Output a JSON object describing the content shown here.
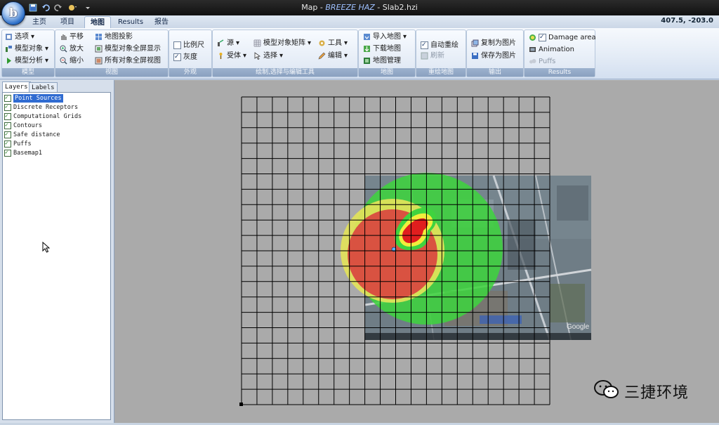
{
  "window": {
    "title_main": "Map - ",
    "title_brand": "BREEZE HAZ",
    "title_file": " - Slab2.hzi",
    "coordinates": "407.5, -203.0"
  },
  "tabs": [
    {
      "label": "主页",
      "active": false
    },
    {
      "label": "项目",
      "active": false
    },
    {
      "label": "地图",
      "active": true
    },
    {
      "label": "Results",
      "active": false
    },
    {
      "label": "报告",
      "active": false
    }
  ],
  "ribbon": {
    "model": {
      "label": "模型",
      "options": "选项",
      "model_objects": "模型对象",
      "model_analysis": "模型分析"
    },
    "view": {
      "label": "视图",
      "pan": "平移",
      "zoom_in": "放大",
      "zoom_out": "缩小",
      "map_projection": "地图投影",
      "fit_model_objects": "模型对象全屏显示",
      "fit_all_objects": "所有对象全屏视图"
    },
    "appearance": {
      "label": "外观",
      "scale": "比例尺",
      "grayscale": "灰度"
    },
    "draw": {
      "label": "绘制,选择与编辑工具",
      "source": "源",
      "receptor": "受体",
      "object_matrix": "模型对象矩阵",
      "select": "选择",
      "tools": "工具",
      "edit": "编辑"
    },
    "map": {
      "label": "地图",
      "import_map": "导入地图",
      "download_map": "下载地图",
      "map_manager": "地图管理"
    },
    "redraw": {
      "label": "重绘地图",
      "auto_redraw": "自动重绘",
      "refresh": "刷新"
    },
    "output": {
      "label": "输出",
      "copy_image": "复制为图片",
      "save_image": "保存为图片"
    },
    "results": {
      "label": "Results",
      "damage_area": "Damage area",
      "animation": "Animation",
      "puffs": "Puffs"
    }
  },
  "left_panel": {
    "tabs": [
      "Layers",
      "Labels"
    ],
    "layers": [
      {
        "label": "Point Sources",
        "checked": true,
        "selected": true
      },
      {
        "label": "Discrete Receptors",
        "checked": true,
        "selected": false
      },
      {
        "label": "Computational Grids",
        "checked": true,
        "selected": false
      },
      {
        "label": "Contours",
        "checked": true,
        "selected": false
      },
      {
        "label": "Safe distance",
        "checked": true,
        "selected": false
      },
      {
        "label": "Puffs",
        "checked": true,
        "selected": false
      },
      {
        "label": "Basemap1",
        "checked": true,
        "selected": false
      }
    ]
  },
  "map": {
    "grid_columns": 20,
    "grid_rows": 20,
    "zone_colors": {
      "outer": "#3fd33f",
      "middle": "#e3e35a",
      "inner": "#d93d3d",
      "background": "#aaaaaa"
    },
    "basemap_attribution": "Google"
  },
  "watermark": {
    "text": "三捷环境",
    "icon": "wechat-icon"
  }
}
